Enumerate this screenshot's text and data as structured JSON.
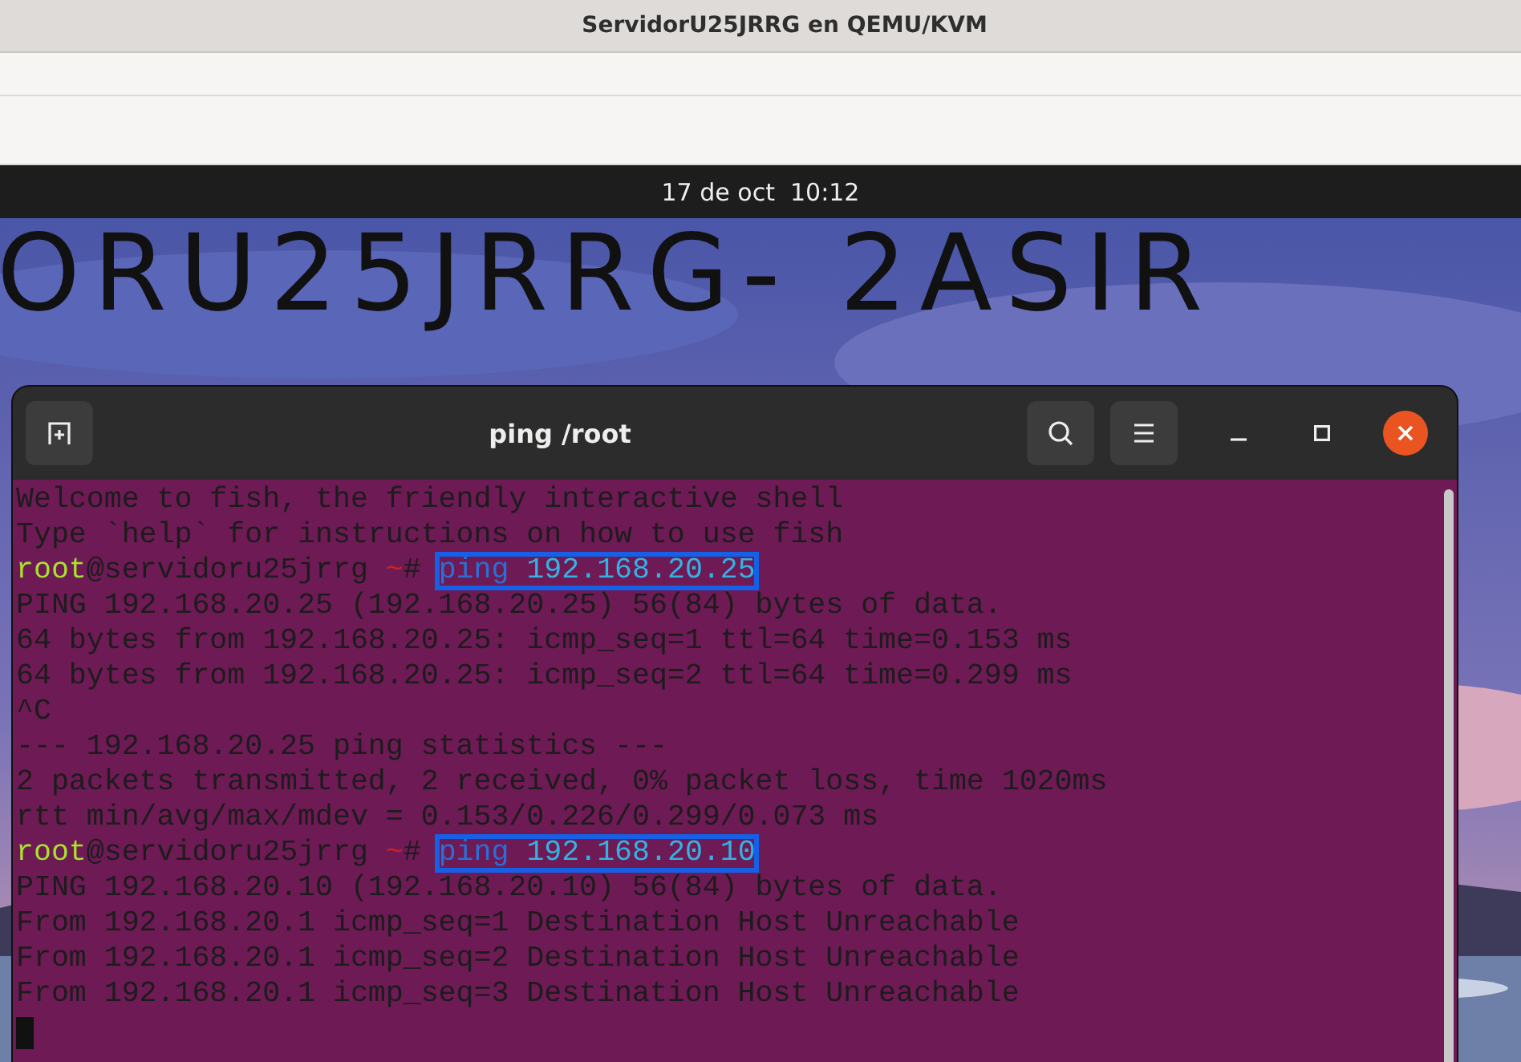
{
  "window": {
    "title": "ServidorU25JRRG en QEMU/KVM"
  },
  "top_bar": {
    "clock": "17 de oct  10:12"
  },
  "desktop": {
    "wallpaper": {
      "kind": "picture",
      "banner": "ORU25JRRG- 2ASIR"
    }
  },
  "terminal": {
    "title": "ping /root",
    "buttons": [
      {
        "kind": "new-tab"
      },
      {
        "kind": "search"
      },
      {
        "kind": "menu"
      },
      {
        "kind": "minimize"
      },
      {
        "kind": "maximize"
      },
      {
        "kind": "close"
      }
    ],
    "lines": [
      {
        "kind": "output",
        "text": "Welcome to fish, the friendly interactive shell"
      },
      {
        "kind": "output",
        "text": "Type `help` for instructions on how to use fish"
      },
      {
        "kind": "prompt",
        "user": "root",
        "host": "@servidoru25jrrg",
        "cwd": "~",
        "symbol": "#",
        "program": "ping",
        "args": "192.168.20.25",
        "highlighted": true
      },
      {
        "kind": "output",
        "text": "PING 192.168.20.25 (192.168.20.25) 56(84) bytes of data."
      },
      {
        "kind": "output",
        "text": "64 bytes from 192.168.20.25: icmp_seq=1 ttl=64 time=0.153 ms"
      },
      {
        "kind": "output",
        "text": "64 bytes from 192.168.20.25: icmp_seq=2 ttl=64 time=0.299 ms"
      },
      {
        "kind": "output",
        "text": "^C"
      },
      {
        "kind": "output",
        "text": "--- 192.168.20.25 ping statistics ---"
      },
      {
        "kind": "output",
        "text": "2 packets transmitted, 2 received, 0% packet loss, time 1020ms"
      },
      {
        "kind": "output",
        "text": "rtt min/avg/max/mdev = 0.153/0.226/0.299/0.073 ms"
      },
      {
        "kind": "prompt",
        "user": "root",
        "host": "@servidoru25jrrg",
        "cwd": "~",
        "symbol": "#",
        "program": "ping",
        "args": "192.168.20.10",
        "highlighted": true
      },
      {
        "kind": "output",
        "text": "PING 192.168.20.10 (192.168.20.10) 56(84) bytes of data."
      },
      {
        "kind": "output",
        "text": "From 192.168.20.1 icmp_seq=1 Destination Host Unreachable"
      },
      {
        "kind": "output",
        "text": "From 192.168.20.1 icmp_seq=2 Destination Host Unreachable"
      },
      {
        "kind": "output",
        "text": "From 192.168.20.1 icmp_seq=3 Destination Host Unreachable"
      },
      {
        "kind": "cursor"
      }
    ]
  }
}
